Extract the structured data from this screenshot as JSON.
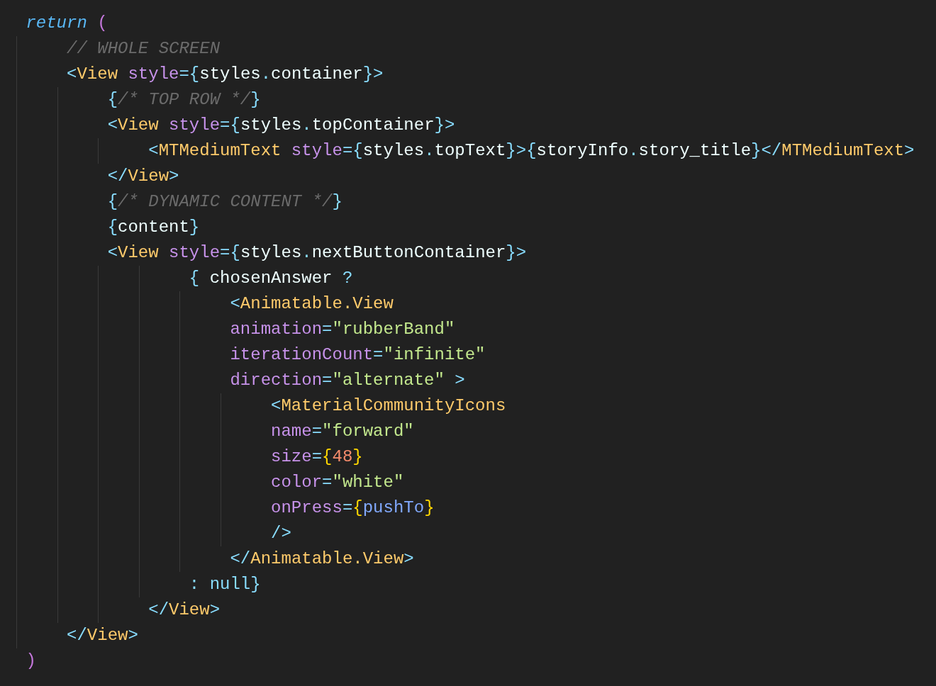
{
  "editor": {
    "lines": [
      {
        "tokens": [
          {
            "text": "return",
            "kind": "keyword"
          },
          {
            "text": " (",
            "kind": "paren"
          }
        ]
      },
      {
        "tokens": [
          {
            "text": "    // WHOLE SCREEN",
            "kind": "comment"
          }
        ]
      },
      {
        "tokens": [
          {
            "text": "    <",
            "kind": "punc"
          },
          {
            "text": "View",
            "kind": "tag"
          },
          {
            "text": " style",
            "kind": "attr"
          },
          {
            "text": "={",
            "kind": "punc"
          },
          {
            "text": "styles",
            "kind": "plain"
          },
          {
            "text": ".",
            "kind": "punc"
          },
          {
            "text": "container",
            "kind": "plain"
          },
          {
            "text": "}>",
            "kind": "punc"
          }
        ]
      },
      {
        "tokens": [
          {
            "text": "        {",
            "kind": "punc"
          },
          {
            "text": "/* TOP ROW */",
            "kind": "comment"
          },
          {
            "text": "}",
            "kind": "punc"
          }
        ]
      },
      {
        "tokens": [
          {
            "text": "        <",
            "kind": "punc"
          },
          {
            "text": "View",
            "kind": "tag"
          },
          {
            "text": " style",
            "kind": "attr"
          },
          {
            "text": "={",
            "kind": "punc"
          },
          {
            "text": "styles",
            "kind": "plain"
          },
          {
            "text": ".",
            "kind": "punc"
          },
          {
            "text": "topContainer",
            "kind": "plain"
          },
          {
            "text": "}>",
            "kind": "punc"
          }
        ]
      },
      {
        "tokens": [
          {
            "text": "            <",
            "kind": "punc"
          },
          {
            "text": "MTMediumText",
            "kind": "tag"
          },
          {
            "text": " style",
            "kind": "attr"
          },
          {
            "text": "={",
            "kind": "punc"
          },
          {
            "text": "styles",
            "kind": "plain"
          },
          {
            "text": ".",
            "kind": "punc"
          },
          {
            "text": "topText",
            "kind": "plain"
          },
          {
            "text": "}>{",
            "kind": "punc"
          },
          {
            "text": "storyInfo",
            "kind": "plain"
          },
          {
            "text": ".",
            "kind": "punc"
          },
          {
            "text": "story_title",
            "kind": "plain"
          },
          {
            "text": "}</",
            "kind": "punc"
          },
          {
            "text": "MTMediumText",
            "kind": "tag"
          },
          {
            "text": ">",
            "kind": "punc"
          }
        ]
      },
      {
        "tokens": [
          {
            "text": "        </",
            "kind": "punc"
          },
          {
            "text": "View",
            "kind": "tag"
          },
          {
            "text": ">",
            "kind": "punc"
          }
        ]
      },
      {
        "tokens": [
          {
            "text": "        {",
            "kind": "punc"
          },
          {
            "text": "/* DYNAMIC CONTENT */",
            "kind": "comment"
          },
          {
            "text": "}",
            "kind": "punc"
          }
        ]
      },
      {
        "tokens": [
          {
            "text": "        {",
            "kind": "punc"
          },
          {
            "text": "content",
            "kind": "plain"
          },
          {
            "text": "}",
            "kind": "punc"
          }
        ]
      },
      {
        "tokens": [
          {
            "text": "        <",
            "kind": "punc"
          },
          {
            "text": "View",
            "kind": "tag"
          },
          {
            "text": " style",
            "kind": "attr"
          },
          {
            "text": "={",
            "kind": "punc"
          },
          {
            "text": "styles",
            "kind": "plain"
          },
          {
            "text": ".",
            "kind": "punc"
          },
          {
            "text": "nextButtonContainer",
            "kind": "plain"
          },
          {
            "text": "}>",
            "kind": "punc"
          }
        ]
      },
      {
        "tokens": [
          {
            "text": "                {",
            "kind": "punc"
          },
          {
            "text": " chosenAnswer ",
            "kind": "plain"
          },
          {
            "text": "?",
            "kind": "punc"
          }
        ]
      },
      {
        "tokens": [
          {
            "text": "                    <",
            "kind": "punc"
          },
          {
            "text": "Animatable.View",
            "kind": "tag"
          }
        ]
      },
      {
        "tokens": [
          {
            "text": "                    animation",
            "kind": "attr"
          },
          {
            "text": "=",
            "kind": "punc"
          },
          {
            "text": "\"rubberBand\"",
            "kind": "string"
          }
        ]
      },
      {
        "tokens": [
          {
            "text": "                    iterationCount",
            "kind": "attr"
          },
          {
            "text": "=",
            "kind": "punc"
          },
          {
            "text": "\"infinite\"",
            "kind": "string"
          }
        ]
      },
      {
        "tokens": [
          {
            "text": "                    direction",
            "kind": "attr"
          },
          {
            "text": "=",
            "kind": "punc"
          },
          {
            "text": "\"alternate\"",
            "kind": "string"
          },
          {
            "text": " >",
            "kind": "punc"
          }
        ]
      },
      {
        "tokens": [
          {
            "text": "                        <",
            "kind": "punc"
          },
          {
            "text": "MaterialCommunityIcons",
            "kind": "tag"
          }
        ]
      },
      {
        "tokens": [
          {
            "text": "                        name",
            "kind": "attr"
          },
          {
            "text": "=",
            "kind": "punc"
          },
          {
            "text": "\"forward\"",
            "kind": "string"
          }
        ]
      },
      {
        "tokens": [
          {
            "text": "                        size",
            "kind": "attr"
          },
          {
            "text": "=",
            "kind": "punc"
          },
          {
            "text": "{",
            "kind": "brace"
          },
          {
            "text": "48",
            "kind": "number"
          },
          {
            "text": "}",
            "kind": "brace"
          }
        ]
      },
      {
        "tokens": [
          {
            "text": "                        color",
            "kind": "attr"
          },
          {
            "text": "=",
            "kind": "punc"
          },
          {
            "text": "\"white\"",
            "kind": "string"
          }
        ]
      },
      {
        "tokens": [
          {
            "text": "                        onPress",
            "kind": "attr"
          },
          {
            "text": "=",
            "kind": "punc"
          },
          {
            "text": "{",
            "kind": "brace"
          },
          {
            "text": "pushTo",
            "kind": "function"
          },
          {
            "text": "}",
            "kind": "brace"
          }
        ]
      },
      {
        "tokens": [
          {
            "text": "                        />",
            "kind": "punc"
          }
        ]
      },
      {
        "tokens": [
          {
            "text": "                    </",
            "kind": "punc"
          },
          {
            "text": "Animatable.View",
            "kind": "tag"
          },
          {
            "text": ">",
            "kind": "punc"
          }
        ]
      },
      {
        "tokens": [
          {
            "text": "                : null}",
            "kind": "punc"
          }
        ]
      },
      {
        "tokens": [
          {
            "text": "            </",
            "kind": "punc"
          },
          {
            "text": "View",
            "kind": "tag"
          },
          {
            "text": ">",
            "kind": "punc"
          }
        ]
      },
      {
        "tokens": [
          {
            "text": "    </",
            "kind": "punc"
          },
          {
            "text": "View",
            "kind": "tag"
          },
          {
            "text": ">",
            "kind": "punc"
          }
        ]
      },
      {
        "tokens": [
          {
            "text": ")",
            "kind": "paren"
          }
        ]
      }
    ]
  }
}
